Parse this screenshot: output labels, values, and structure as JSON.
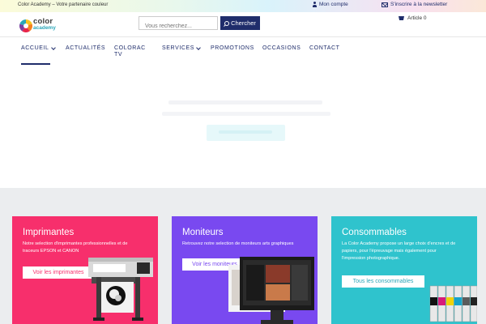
{
  "topbar": {
    "tagline": "Color Academy – Votre partenaire couleur",
    "account_label": "Mon compte",
    "newsletter_label": "S'inscrire à la newsletter"
  },
  "header": {
    "logo_word1": "color",
    "logo_word2": "academy",
    "search_placeholder": "Vous recherchez...",
    "search_button": "Chercher",
    "cart_label": "Article 0"
  },
  "nav": {
    "items": [
      {
        "label": "ACCUEIL",
        "has_dropdown": true,
        "active": true
      },
      {
        "label": "ACTUALITÉS"
      },
      {
        "label": "COLORAC",
        "label2": "TV"
      },
      {
        "label": "SERVICES",
        "has_dropdown": true
      },
      {
        "label": "PROMOTIONS"
      },
      {
        "label": "OCCASIONS"
      },
      {
        "label": "CONTACT"
      }
    ]
  },
  "cards": [
    {
      "title": "Imprimantes",
      "desc1": "Notre selection d'imprimantes professionnelles et de",
      "desc2": "traceurs EPSON et CANON",
      "button": "Voir les imprimantes",
      "color": "#f72f6c"
    },
    {
      "title": "Moniteurs",
      "desc1": "Retrouvez notre selection de moniteurs arts graphiques",
      "button": "Voir les moniteurs",
      "color": "#7949f0"
    },
    {
      "title": "Consommables",
      "desc1": "La Color Academy propose un large choix d'encres et  de",
      "desc2": "papiers, pour l'épreuvage mais également pour",
      "desc3": "l'impression photographique.",
      "button": "Tous les consommables",
      "color": "#2fc3cd"
    }
  ],
  "colors": {
    "brand_navy": "#1f2d6b",
    "section_bg": "#ebedef"
  }
}
